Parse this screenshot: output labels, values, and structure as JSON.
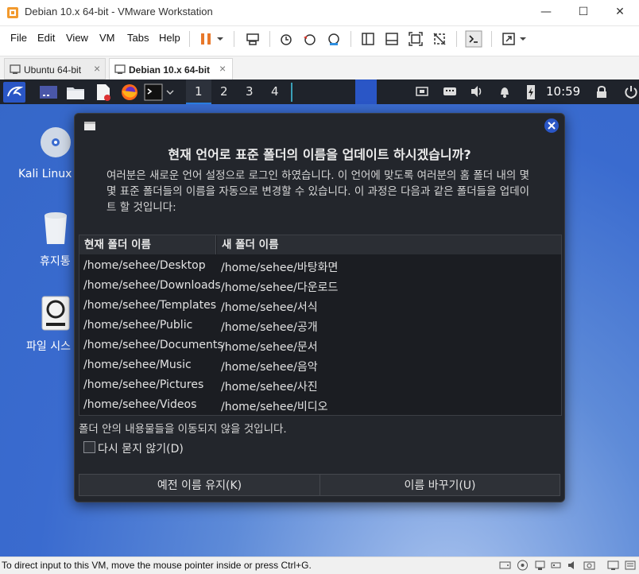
{
  "window": {
    "title": "Debian 10.x 64-bit - VMware Workstation",
    "minimize_glyph": "—",
    "maximize_glyph": "☐",
    "close_glyph": "✕"
  },
  "menu": [
    "File",
    "Edit",
    "View",
    "VM",
    "Tabs",
    "Help"
  ],
  "tabs": [
    {
      "label": "Ubuntu 64-bit",
      "active": false,
      "close": "×"
    },
    {
      "label": "Debian 10.x 64-bit",
      "active": true,
      "close": "×"
    }
  ],
  "panel": {
    "workspaces": [
      "1",
      "2",
      "3",
      "4"
    ],
    "clock": "10:59"
  },
  "desktop": {
    "icons": [
      {
        "label": "Kali Linux a",
        "icon": "disc-icon"
      },
      {
        "label": "휴지통",
        "icon": "trash-icon"
      },
      {
        "label": "파일 시스",
        "icon": "drive-icon"
      }
    ]
  },
  "dialog": {
    "heading": "현재 언어로 표준 폴더의 이름을 업데이트 하시겠습니까?",
    "description": "여러분은 새로운 언어 설정으로 로그인 하였습니다. 이 언어에 맞도록 여러분의 홈 폴더 내의 몇몇 표준 폴더들의 이름을 자동으로 변경할 수 있습니다. 이 과정은 다음과 같은 폴더들을 업데이트 할 것입니다:",
    "columns": [
      "현재 폴더 이름",
      "새 폴더 이름"
    ],
    "rows": [
      [
        "/home/sehee/Desktop",
        "/home/sehee/바탕화면"
      ],
      [
        "/home/sehee/Downloads",
        "/home/sehee/다운로드"
      ],
      [
        "/home/sehee/Templates",
        "/home/sehee/서식"
      ],
      [
        "/home/sehee/Public",
        "/home/sehee/공개"
      ],
      [
        "/home/sehee/Documents",
        "/home/sehee/문서"
      ],
      [
        "/home/sehee/Music",
        "/home/sehee/음악"
      ],
      [
        "/home/sehee/Pictures",
        "/home/sehee/사진"
      ],
      [
        "/home/sehee/Videos",
        "/home/sehee/비디오"
      ]
    ],
    "note": "폴더 안의 내용물들을 이동되지 않을 것입니다.",
    "checkbox_label": "다시 묻지 않기(D)",
    "checkbox_checked": false,
    "keep_button": "예전 이름 유지(K)",
    "rename_button": "이름 바꾸기(U)"
  },
  "status_bar": {
    "text": "To direct input to this VM, move the mouse pointer inside or press Ctrl+G."
  },
  "colors": {
    "dialog_bg": "#23262c",
    "panel_bg": "#1f232b",
    "accent_blue": "#2a56c6",
    "pause_orange": "#e8782a"
  }
}
